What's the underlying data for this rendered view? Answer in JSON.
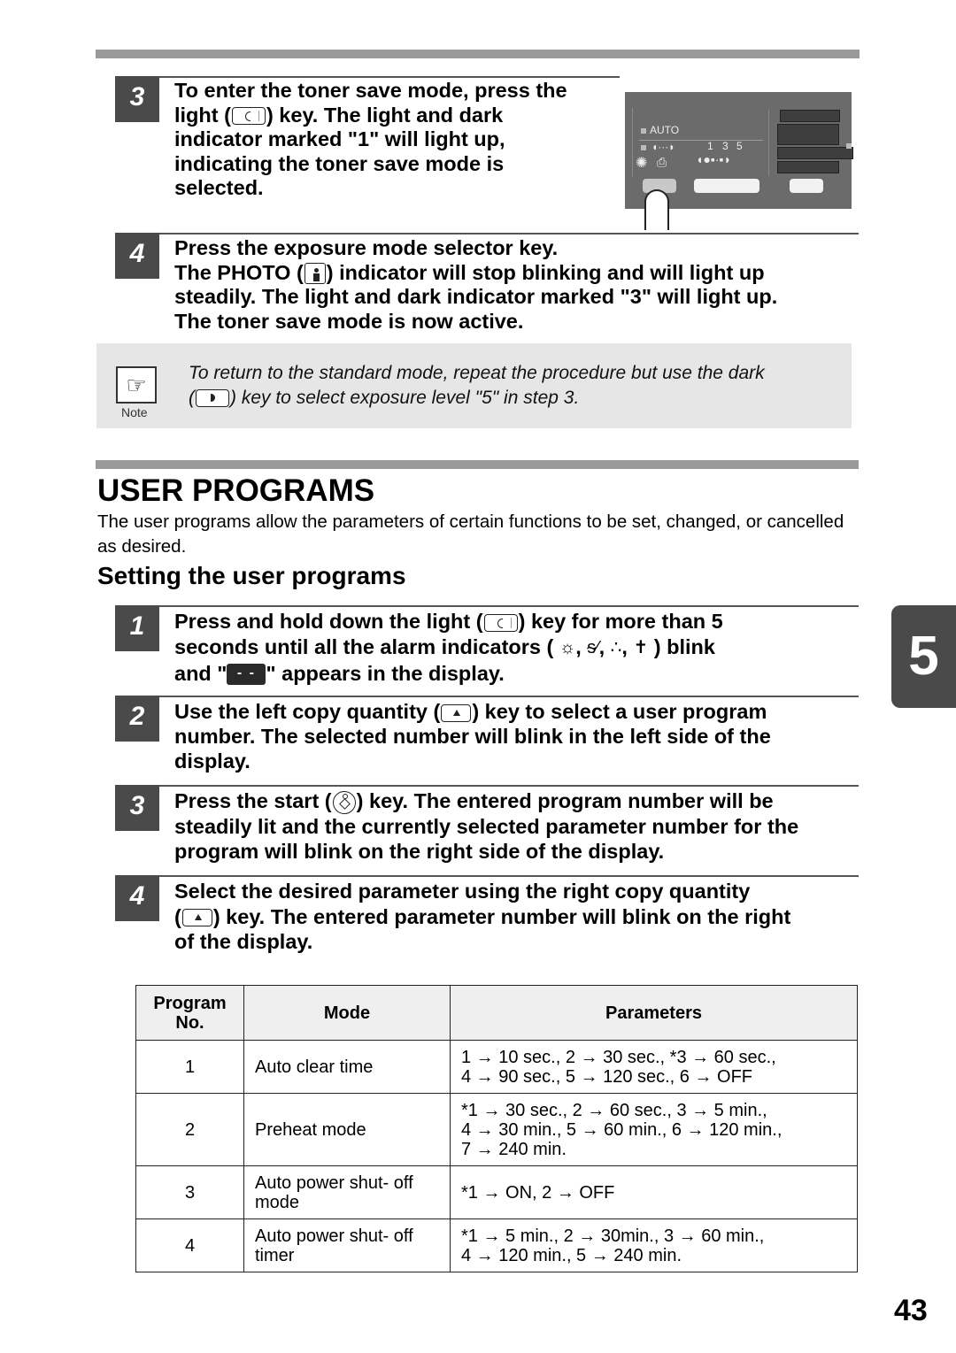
{
  "section_prev": {
    "step3": {
      "num": "3",
      "lines": [
        "To enter the toner save mode, press the",
        "light (",
        ") key. The light and dark",
        "indicator marked \"1\" will light up,",
        "indicating the toner save mode is",
        "selected."
      ]
    },
    "panel": {
      "auto_label": "AUTO",
      "levels": [
        "1",
        "3",
        "5"
      ]
    },
    "step4": {
      "num": "4",
      "line1": "Press the exposure mode selector key.",
      "line2a": "The PHOTO (",
      "line2b": ") indicator will stop blinking and will light up",
      "line3": "steadily. The light and dark indicator marked \"3\" will light up.",
      "line4": "The toner save mode is now active."
    },
    "note": {
      "label": "Note",
      "icon": "pointing-hand-icon",
      "line1": "To return to the standard mode, repeat the procedure but use the dark",
      "line2a": "(",
      "line2b": ") key to select exposure level \"5\" in step 3."
    }
  },
  "heading": "USER PROGRAMS",
  "intro": "The user programs allow the parameters of certain functions to be set, changed, or cancelled as desired.",
  "subheading": "Setting the user programs",
  "steps": [
    {
      "num": "1",
      "l1a": "Press and hold down the light (",
      "l1b": ") key for more than 5",
      "l2a": "seconds until all the alarm indicators (",
      "alarm_icons": [
        "☼",
        "ᵴ⁄",
        "∴",
        "✝"
      ],
      "l2b": ") blink",
      "l3a": "and \"",
      "display": "- -",
      "l3b": "\" appears in the display."
    },
    {
      "num": "2",
      "l1a": "Use the left copy quantity (",
      "l1b": ") key to select a user program",
      "l2": "number. The selected number will blink in the left side of the",
      "l3": "display."
    },
    {
      "num": "3",
      "l1a": "Press the start (",
      "l1b": ") key. The entered program number will be",
      "l2": "steadily lit and the currently selected parameter number for the",
      "l3": "program will blink on the right side of the display."
    },
    {
      "num": "4",
      "l1": "Select the desired parameter using the right copy quantity",
      "l2a": "(",
      "l2b": ") key. The entered parameter number will blink on the right",
      "l3": "of the display."
    }
  ],
  "table": {
    "headers": [
      "Program No.",
      "Mode",
      "Parameters"
    ],
    "rows": [
      {
        "no": "1",
        "mode": "Auto clear time",
        "params": [
          "1 → 10 sec., 2 → 30 sec., *3 → 60 sec.,",
          "4 → 90 sec., 5 → 120 sec., 6 → OFF"
        ]
      },
      {
        "no": "2",
        "mode": "Preheat mode",
        "params": [
          "*1 → 30 sec., 2 → 60 sec., 3 → 5 min.,",
          "4 → 30 min., 5 → 60 min., 6 → 120 min.,",
          "7 → 240 min."
        ]
      },
      {
        "no": "3",
        "mode": "Auto power shut- off mode",
        "params": [
          "*1 → ON, 2 → OFF"
        ]
      },
      {
        "no": "4",
        "mode": "Auto power shut- off timer",
        "params": [
          "*1 → 5 min., 2 → 30min., 3 → 60 min.,",
          "4 → 120 min., 5 → 240 min."
        ]
      }
    ]
  },
  "chapter_tab": "5",
  "page_number": "43"
}
